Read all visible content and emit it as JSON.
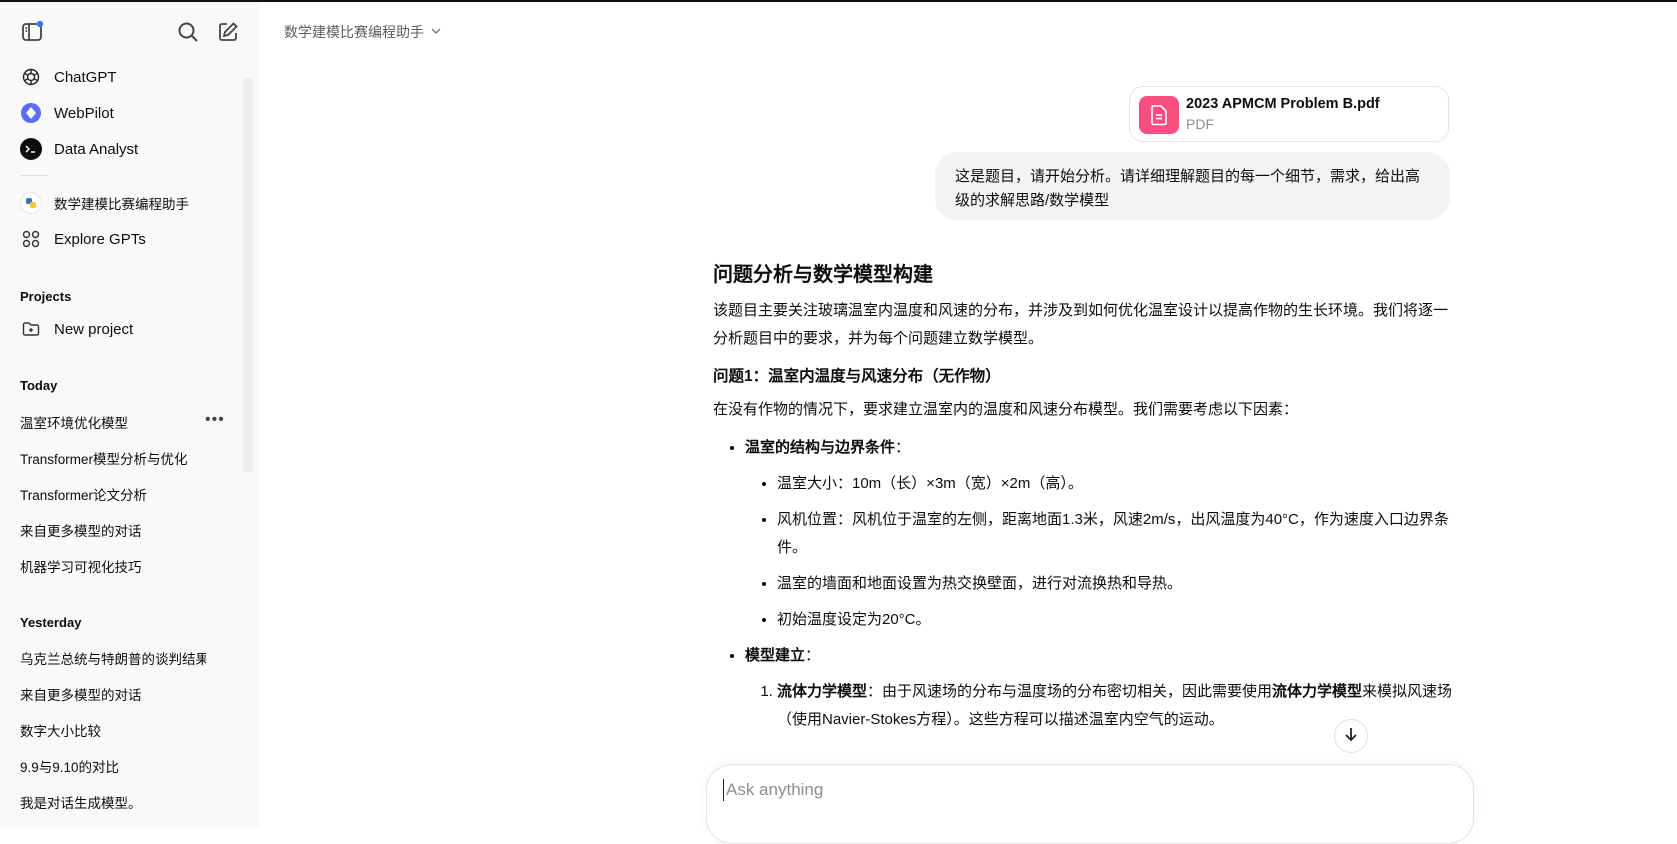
{
  "sidebar": {
    "gpts": [
      {
        "label": "ChatGPT",
        "icon": "openai-logo-icon"
      },
      {
        "label": "WebPilot",
        "icon": "webpilot-logo-icon"
      },
      {
        "label": "Data Analyst",
        "icon": "terminal-logo-icon"
      }
    ],
    "gpt_current": "数学建模比赛编程助手",
    "explore": "Explore GPTs",
    "projects_heading": "Projects",
    "new_project": "New project",
    "today_heading": "Today",
    "today": [
      "温室环境优化模型",
      "Transformer模型分析与优化",
      "Transformer论文分析",
      "来自更多模型的对话",
      "机器学习可视化技巧"
    ],
    "yesterday_heading": "Yesterday",
    "yesterday": [
      "乌克兰总统与特朗普的谈判结果",
      "来自更多模型的对话",
      "数字大小比较",
      "9.9与9.10的对比",
      "我是对话生成模型。"
    ]
  },
  "header": {
    "model_name": "数学建模比赛编程助手"
  },
  "attachment": {
    "filename": "2023 APMCM Problem B.pdf",
    "type": "PDF"
  },
  "user_message": "这是题目，请开始分析。请详细理解题目的每一个细节，需求，给出高级的求解思路/数学模型",
  "answer": {
    "title": "问题分析与数学模型构建",
    "intro": "该题目主要关注玻璃温室内温度和风速的分布，并涉及到如何优化温室设计以提高作物的生长环境。我们将逐一分析题目中的要求，并为每个问题建立数学模型。",
    "q1_heading": "问题1：温室内温度与风速分布（无作物）",
    "q1_text": "在没有作物的情况下，要求建立温室内的温度和风速分布模型。我们需要考虑以下因素：",
    "b1_title": "温室的结构与边界条件",
    "b1_colon": "：",
    "b1_items": [
      "温室大小：10m（长）×3m（宽）×2m（高）。",
      "风机位置：风机位于温室的左侧，距离地面1.3米，风速2m/s，出风温度为40°C，作为速度入口边界条件。",
      "温室的墙面和地面设置为热交换壁面，进行对流换热和导热。",
      "初始温度设定为20°C。"
    ],
    "b2_title": "模型建立",
    "b2_colon": "：",
    "n1_bold": "流体力学模型",
    "n1_text1": "：由于风速场的分布与温度场的分布密切相关，因此需要使用",
    "n1_bold2": "流体力学模型",
    "n1_text2": "来模拟风速场（使用Navier-Stokes方程）。这些方程可以描述温室内空气的运动。"
  },
  "composer": {
    "placeholder": "Ask anything"
  },
  "colors": {
    "sidebar_bg": "#f9f9f9",
    "user_bubble": "#f3f3f3",
    "pdf_icon_bg": "#fa4f80"
  }
}
